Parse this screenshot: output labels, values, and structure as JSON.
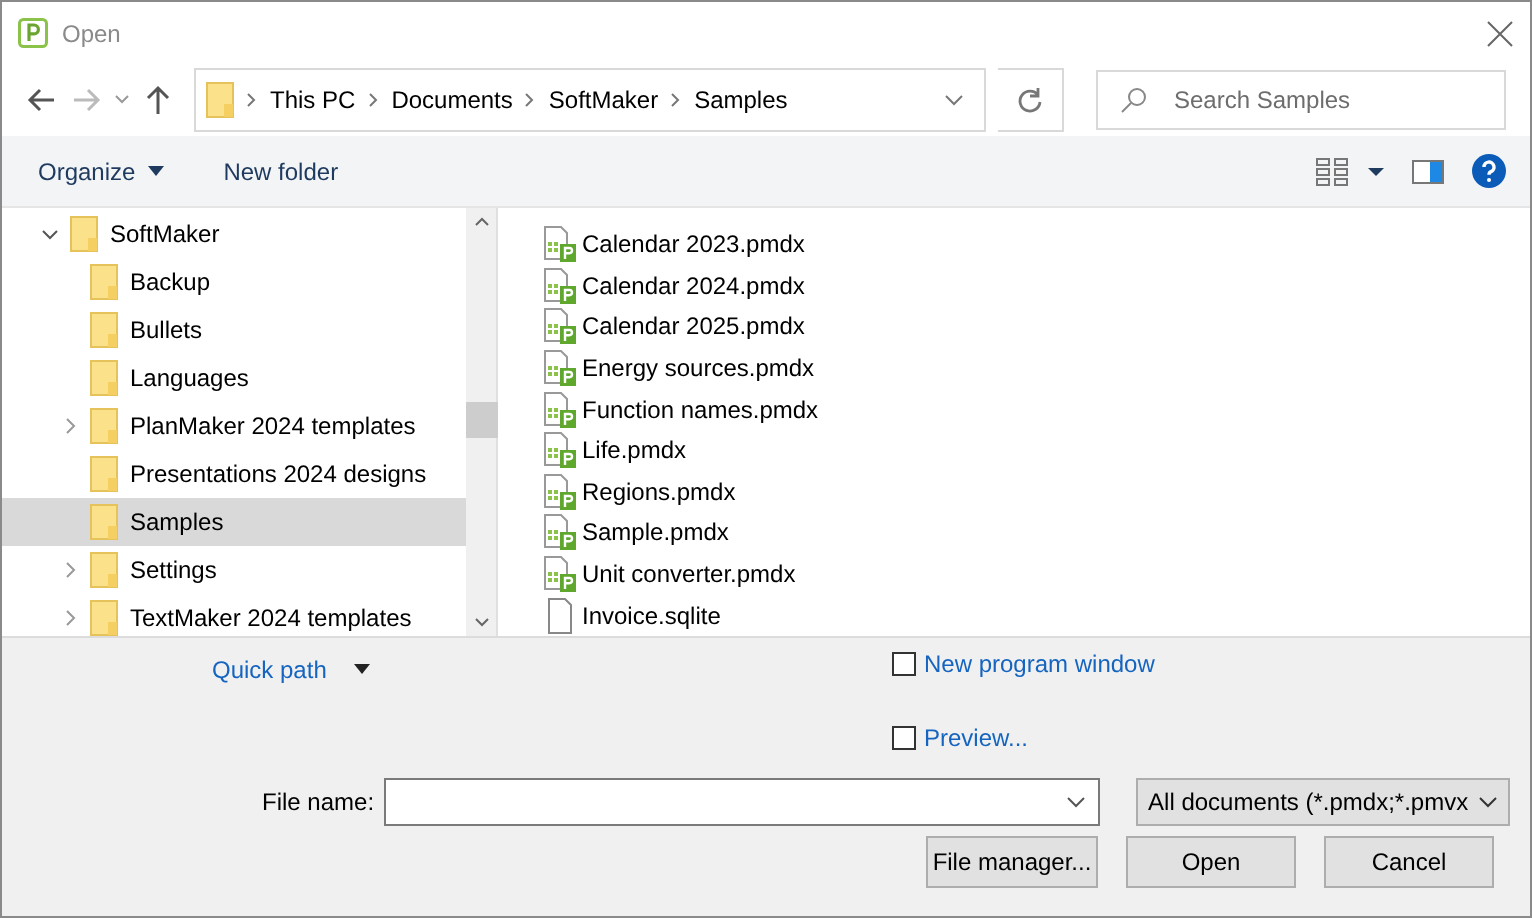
{
  "window": {
    "title": "Open"
  },
  "breadcrumb": [
    "This PC",
    "Documents",
    "SoftMaker",
    "Samples"
  ],
  "search": {
    "placeholder": "Search Samples"
  },
  "toolbar": {
    "organize": "Organize",
    "new_folder": "New folder"
  },
  "tree": [
    {
      "label": "SoftMaker",
      "expanded": true,
      "expandable": true,
      "selected": false,
      "children": [
        {
          "label": "Backup",
          "expandable": false,
          "selected": false
        },
        {
          "label": "Bullets",
          "expandable": false,
          "selected": false
        },
        {
          "label": "Languages",
          "expandable": false,
          "selected": false
        },
        {
          "label": "PlanMaker 2024 templates",
          "expandable": true,
          "selected": false
        },
        {
          "label": "Presentations 2024 designs",
          "expandable": false,
          "selected": false
        },
        {
          "label": "Samples",
          "expandable": false,
          "selected": true
        },
        {
          "label": "Settings",
          "expandable": true,
          "selected": false
        },
        {
          "label": "TextMaker 2024 templates",
          "expandable": true,
          "selected": false
        }
      ]
    }
  ],
  "files": [
    {
      "name": "Calendar 2023.pmdx",
      "kind": "spreadsheet"
    },
    {
      "name": "Calendar 2024.pmdx",
      "kind": "spreadsheet"
    },
    {
      "name": "Calendar 2025.pmdx",
      "kind": "spreadsheet"
    },
    {
      "name": "Energy sources.pmdx",
      "kind": "spreadsheet"
    },
    {
      "name": "Function names.pmdx",
      "kind": "spreadsheet"
    },
    {
      "name": "Life.pmdx",
      "kind": "spreadsheet"
    },
    {
      "name": "Regions.pmdx",
      "kind": "spreadsheet"
    },
    {
      "name": "Sample.pmdx",
      "kind": "spreadsheet"
    },
    {
      "name": "Unit converter.pmdx",
      "kind": "spreadsheet"
    },
    {
      "name": "Invoice.sqlite",
      "kind": "plain"
    }
  ],
  "quick_path": "Quick path",
  "options": [
    {
      "label": "New program window",
      "checked": false
    },
    {
      "label": "Preview...",
      "checked": false
    }
  ],
  "file_name": {
    "label": "File name:"
  },
  "file_type": "All documents (*.pmdx;*.pmvx",
  "buttons": [
    "File manager...",
    "Open",
    "Cancel"
  ]
}
